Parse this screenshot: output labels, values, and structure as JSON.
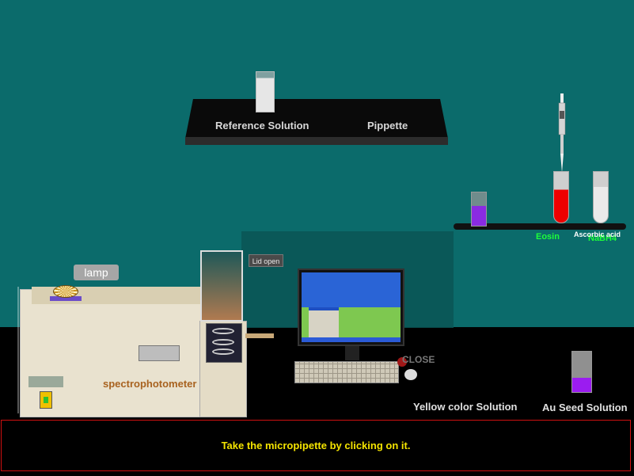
{
  "shelf": {
    "reference_label": "Reference Solution",
    "pipette_label": "Pippette"
  },
  "reagents": {
    "eosin_label": "Eosin",
    "nabh4_label": "NaBH4",
    "ascorbic_label": "Ascorbic acid"
  },
  "tooltips": {
    "lamp": "lamp",
    "lid": "Lid open"
  },
  "instrument": {
    "label": "spectrophotometer"
  },
  "computer": {
    "close_label": "CLOSE"
  },
  "bottom": {
    "yellow_label": "Yellow color Solution",
    "au_seed_label": "Au Seed Solution"
  },
  "instruction": {
    "text": "Take the micropipette by clicking on it."
  },
  "colors": {
    "wall": "#0b6b6b",
    "instruction_text": "#f4e400",
    "instruction_border": "#d01010",
    "reagent_label": "#1dff3a"
  },
  "icons": {
    "lamp": "lamp-icon",
    "micropipette": "micropipette-icon",
    "cuvette": "cuvette-icon",
    "test_tube": "test-tube-icon"
  }
}
